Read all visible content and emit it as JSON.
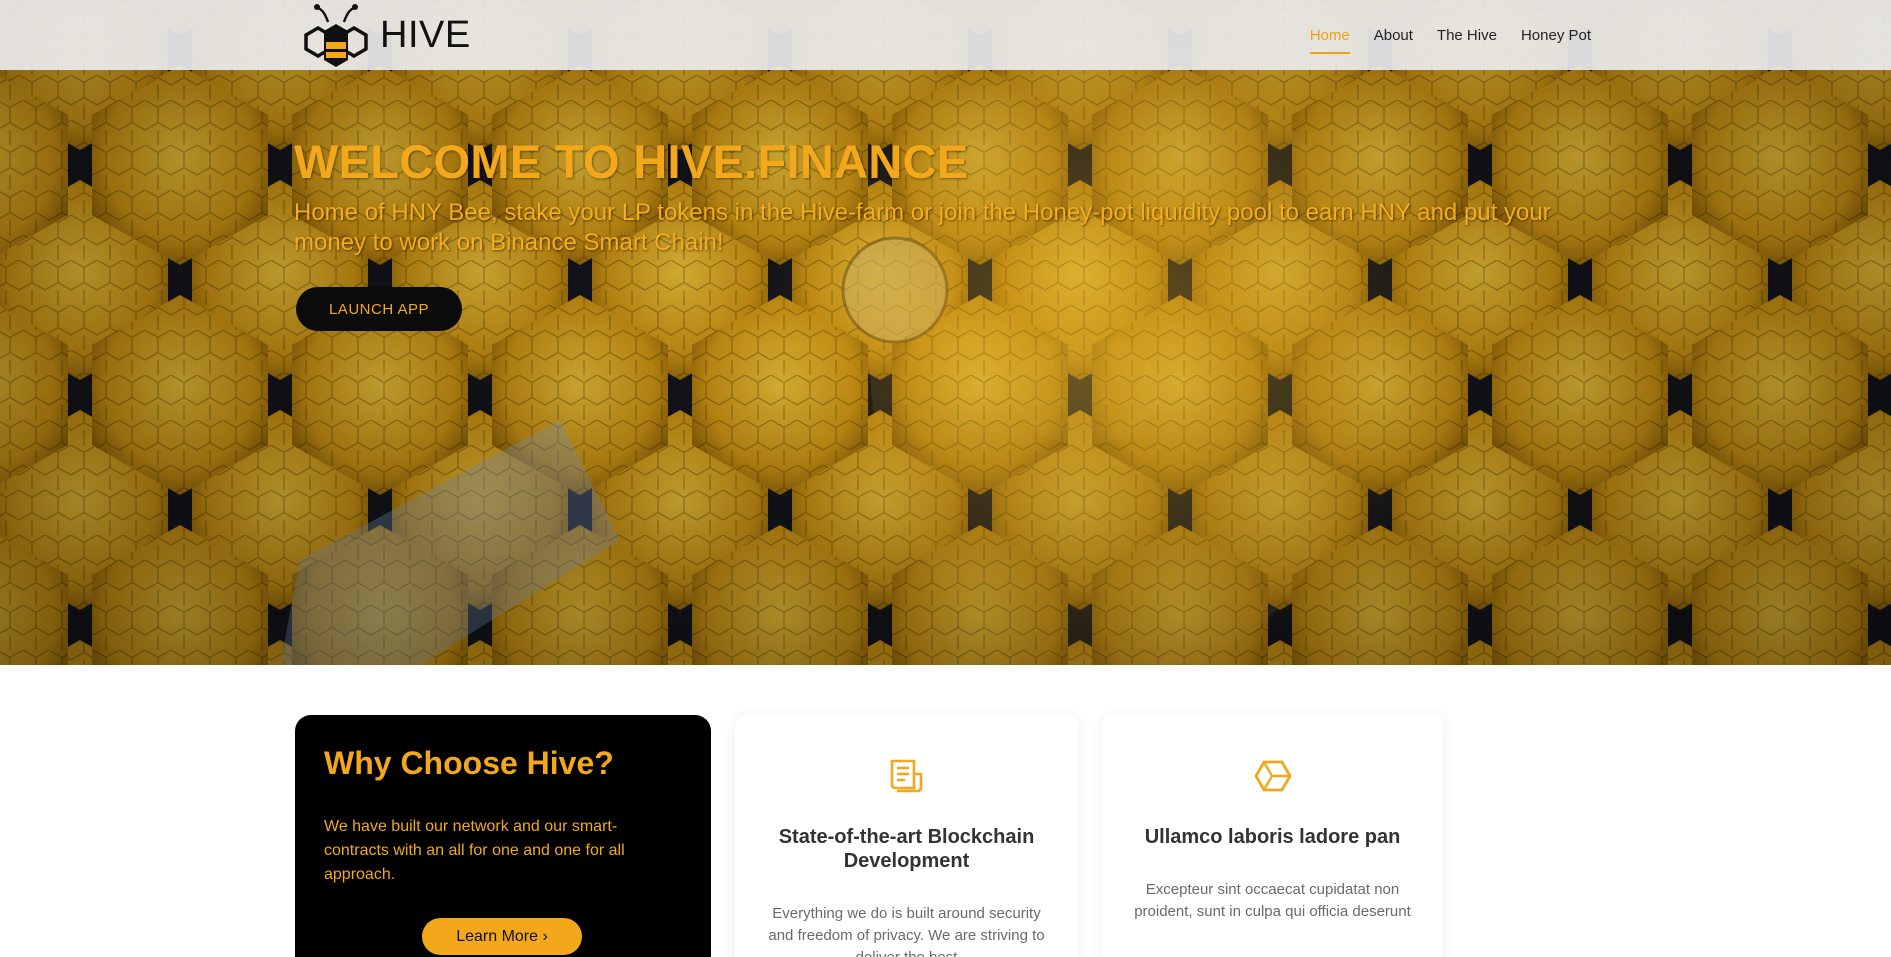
{
  "header": {
    "logo_text": "HIVE",
    "nav": [
      {
        "label": "Home",
        "active": true
      },
      {
        "label": "About",
        "active": false
      },
      {
        "label": "The Hive",
        "active": false
      },
      {
        "label": "Honey Pot",
        "active": false
      }
    ]
  },
  "hero": {
    "title": "WELCOME TO HIVE.FINANCE",
    "subtitle": "Home of HNY Bee, stake your LP tokens in the Hive-farm or join the Honey-pot liquidity pool to earn HNY and put your money to work on Binance Smart Chain!",
    "button": "LAUNCH APP"
  },
  "cards": {
    "why": {
      "title": "Why Choose Hive?",
      "text": "We have built our network and our smart-contracts with an all for one and one for all approach.",
      "button": "Learn More ›"
    },
    "blockchain": {
      "icon": "document-icon",
      "title": "State-of-the-art Blockchain Development",
      "text": "Everything we do is built around security and freedom of privacy. We are striving to deliver the best"
    },
    "ullamco": {
      "icon": "hexagon-icon",
      "title": "Ullamco laboris ladore pan",
      "text": "Excepteur sint occaecat cupidatat non proident, sunt in culpa qui officia deserunt"
    }
  },
  "colors": {
    "accent": "#f3a81c",
    "dark": "#000000",
    "header_bg": "#ececee"
  }
}
